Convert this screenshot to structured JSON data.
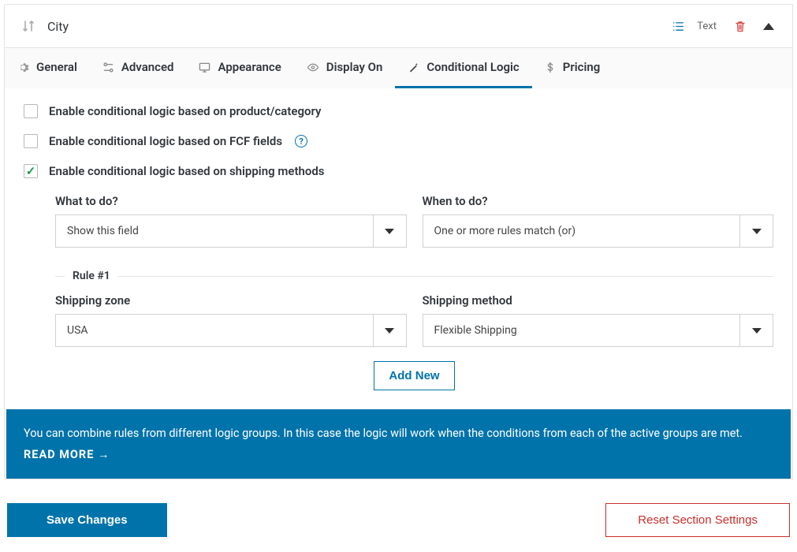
{
  "header": {
    "title": "City",
    "type_label": "Text"
  },
  "tabs": [
    {
      "label": "General"
    },
    {
      "label": "Advanced"
    },
    {
      "label": "Appearance"
    },
    {
      "label": "Display On"
    },
    {
      "label": "Conditional Logic"
    },
    {
      "label": "Pricing"
    }
  ],
  "options": {
    "product": {
      "label": "Enable conditional logic based on product/category",
      "checked": false
    },
    "fcf": {
      "label": "Enable conditional logic based on FCF fields",
      "checked": false
    },
    "shipping": {
      "label": "Enable conditional logic based on shipping methods",
      "checked": true
    }
  },
  "config": {
    "what_label": "What to do?",
    "what_value": "Show this field",
    "when_label": "When to do?",
    "when_value": "One or more rules match (or)"
  },
  "rule": {
    "title": "Rule #1",
    "zone_label": "Shipping zone",
    "zone_value": "USA",
    "method_label": "Shipping method",
    "method_value": "Flexible Shipping"
  },
  "buttons": {
    "add_new": "Add New",
    "save": "Save Changes",
    "reset": "Reset Section Settings"
  },
  "banner": {
    "text": "You can combine rules from different logic groups. In this case the logic will work when the conditions from each of the active groups are met.",
    "read_more": "READ MORE →"
  }
}
